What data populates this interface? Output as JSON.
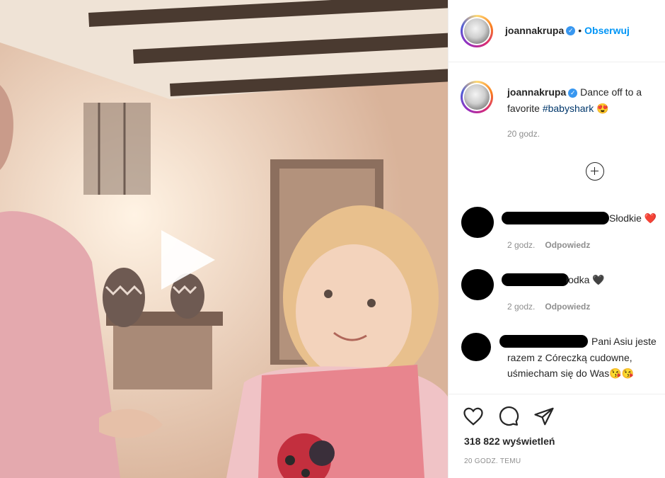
{
  "post": {
    "username": "joannakrupa",
    "follow_label": "Obserwuj",
    "dot": "•",
    "caption_text": "Dance off to a",
    "caption_line2": "favorite",
    "hashtag": "#babyshark",
    "caption_emoji": "😍",
    "caption_time": "20 godz.",
    "views": "318 822 wyświetleń",
    "time_ago": "20 godz. temu"
  },
  "comments": [
    {
      "text": "Słodkie ❤️",
      "time": "2 godz.",
      "reply": "Odpowiedz"
    },
    {
      "text": "łodka 🖤",
      "time": "2 godz.",
      "reply": "Odpowiedz"
    },
    {
      "line1": "Pani Asiu jeste",
      "line2": "razem z Córeczką cudowne,",
      "line3": "uśmiecham się do Was😘😘",
      "time": "",
      "reply": ""
    }
  ],
  "colors": {
    "accent": "#0095f6",
    "verified": "#3897f0",
    "muted": "#8e8e8e"
  },
  "icons": [
    "play-icon",
    "add-comment-icon",
    "heart-icon",
    "comment-icon",
    "share-icon",
    "verified-icon"
  ]
}
